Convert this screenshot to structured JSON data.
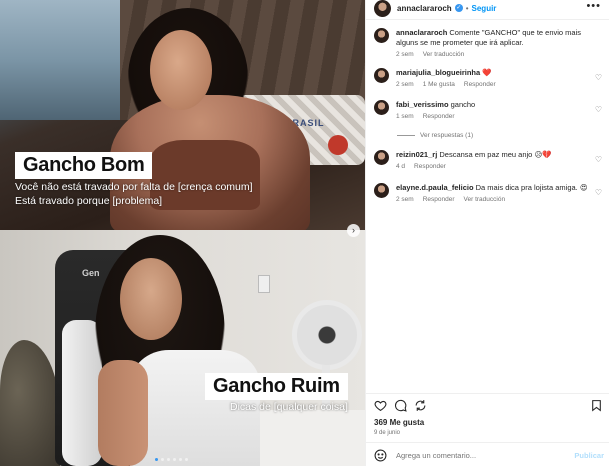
{
  "post": {
    "author": "annaclararoch",
    "follow_label": "Seguir",
    "separator": "•",
    "more_label": "•••",
    "caption": {
      "username": "annaclararoch",
      "text": "Comente \"GANCHO\" que te envio mais alguns se me prometer que irá aplicar.",
      "age": "2 sem",
      "translation_label": "Ver traducción"
    },
    "slides": {
      "top_title": "Gancho Bom",
      "top_line1": "Você não está travado por falta de [crença comum]",
      "top_line2": "Está travado porque [problema]",
      "top_badge": "BRASIL",
      "bottom_title": "Gancho Ruim",
      "bottom_line1": "Dicas de [qualquer coisa]",
      "chair_logo": "Gen"
    }
  },
  "comments": [
    {
      "username": "mariajulia_blogueirinha",
      "text": "",
      "emoji": "❤️",
      "age": "2 sem",
      "likes": "1 Me gusta",
      "reply": "Responder"
    },
    {
      "username": "fabi_verissimo",
      "text": "gancho",
      "age": "1 sem",
      "reply": "Responder",
      "view_replies": "Ver respuestas (1)"
    },
    {
      "username": "reizin021_rj",
      "text": "Descansa em paz meu anjo",
      "emoji": "😥💔",
      "age": "4 d",
      "reply": "Responder"
    },
    {
      "username": "elayne.d.paula_felicio",
      "text": "Da mais dica pra lojista amiga.",
      "emoji": "😍",
      "age": "2 sem",
      "reply": "Responder",
      "translation_label": "Ver traducción"
    }
  ],
  "footer": {
    "likes": "369 Me gusta",
    "date": "9 de junio",
    "comment_placeholder": "Agrega un comentario...",
    "publish_label": "Publicar"
  },
  "icons": {
    "like": "heart-icon",
    "comment": "comment-icon",
    "share": "share-icon",
    "save": "bookmark-icon",
    "emoji": "emoji-icon",
    "next": "chevron-right-icon"
  },
  "colors": {
    "accent_blue": "#0095f6",
    "verified_blue": "#3897f0",
    "muted": "#737373",
    "heart_red": "#ed4956"
  }
}
